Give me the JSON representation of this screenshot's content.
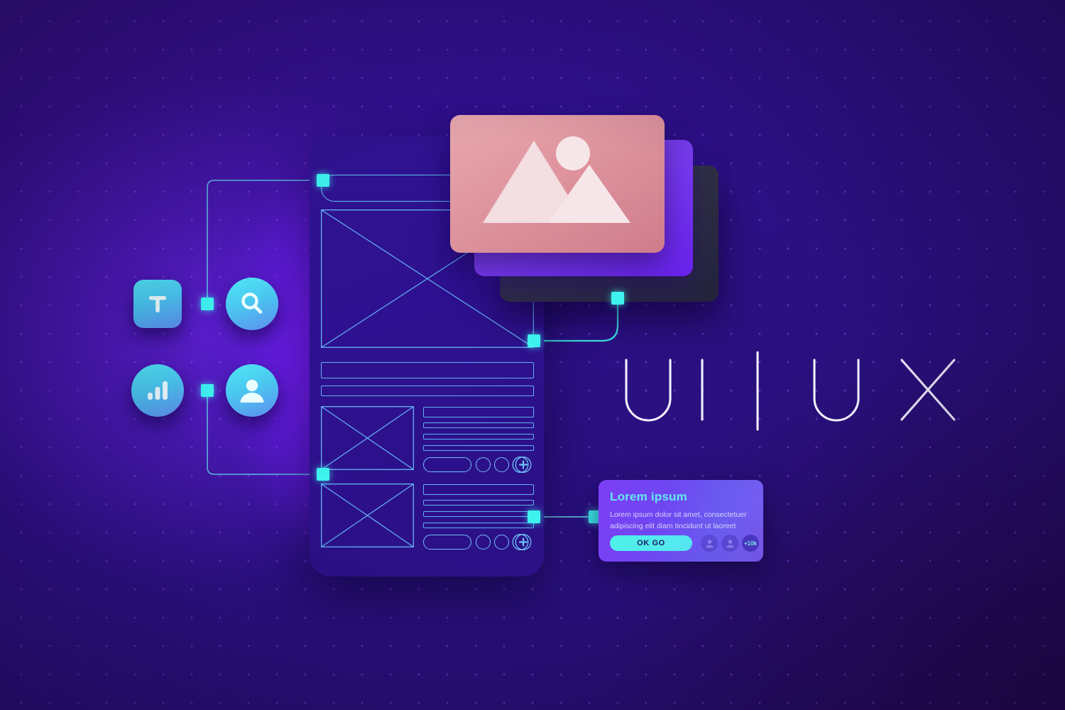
{
  "meta": {
    "title": "UI / UX design concept illustration",
    "background_color": "#2d0e8f",
    "accent_cyan": "#3ef2ef",
    "accent_violet": "#7b3ff4",
    "wireframe_stroke": "#63b6f5"
  },
  "headline": {
    "ui": "U I",
    "separator": "|",
    "ux": "U X",
    "full": "UI | UX"
  },
  "icons": [
    {
      "id": "text-tool",
      "name": "text-tool-icon",
      "glyph": "T",
      "shape": "rounded-square"
    },
    {
      "id": "search",
      "name": "search-icon",
      "glyph": "magnifier",
      "shape": "circle"
    },
    {
      "id": "analytics",
      "name": "bar-chart-icon",
      "glyph": "bar-chart",
      "shape": "circle"
    },
    {
      "id": "profile",
      "name": "user-profile-icon",
      "glyph": "person",
      "shape": "circle"
    }
  ],
  "image_cards": {
    "front": {
      "name": "image-preview-card",
      "color": "#dd929c",
      "content": "mountain-photo-placeholder"
    },
    "middle": {
      "name": "image-card-layer-2",
      "color": "#7b3ff2"
    },
    "back": {
      "name": "image-card-layer-3",
      "color": "#2f3142"
    }
  },
  "phone": {
    "name": "phone-wireframe",
    "search_bar_placeholder": "",
    "blocks": [
      {
        "type": "search-bar"
      },
      {
        "type": "hero-image-placeholder"
      },
      {
        "type": "text-bar"
      },
      {
        "type": "text-bar"
      },
      {
        "type": "list-row"
      },
      {
        "type": "list-row"
      }
    ],
    "row_controls": {
      "pill": "button-pill",
      "circles": 2,
      "plus": "add-circle-icon"
    }
  },
  "lorem_card": {
    "name": "lorem-ipsum-card",
    "heading": "Lorem ipsum",
    "body_line_1": "Lorem ipsum dolor sit amet, consectetuer",
    "body_line_2": "adipiscing elit diam tincidunt ut laoreet",
    "button_label": "OK GO",
    "avatars": 2,
    "more_count": "+10k"
  }
}
